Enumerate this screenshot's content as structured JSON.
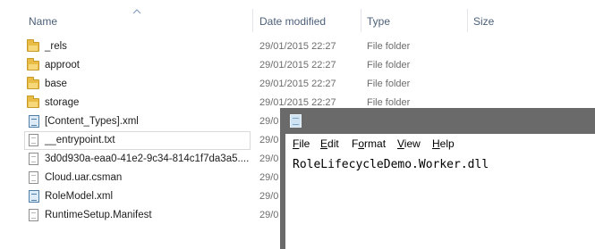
{
  "explorer": {
    "columns": {
      "name": "Name",
      "date_modified": "Date modified",
      "type": "Type",
      "size": "Size"
    },
    "sort_indicator_icon": "sort-ascending-arrow-icon",
    "rows": [
      {
        "name": "_rels",
        "date": "29/01/2015 22:27",
        "type": "File folder",
        "icon": "folder-icon"
      },
      {
        "name": "approot",
        "date": "29/01/2015 22:27",
        "type": "File folder",
        "icon": "folder-icon"
      },
      {
        "name": "base",
        "date": "29/01/2015 22:27",
        "type": "File folder",
        "icon": "folder-icon"
      },
      {
        "name": "storage",
        "date": "29/01/2015 22:27",
        "type": "File folder",
        "icon": "folder-icon"
      },
      {
        "name": "[Content_Types].xml",
        "date": "29/0",
        "type": "",
        "icon": "xml-file-icon"
      },
      {
        "name": "__entrypoint.txt",
        "date": "29/0",
        "type": "",
        "icon": "text-file-icon"
      },
      {
        "name": "3d0d930a-eaa0-41e2-9c34-814c1f7da3a5....",
        "date": "29/0",
        "type": "",
        "icon": "text-file-icon"
      },
      {
        "name": "Cloud.uar.csman",
        "date": "29/0",
        "type": "",
        "icon": "text-file-icon"
      },
      {
        "name": "RoleModel.xml",
        "date": "29/0",
        "type": "",
        "icon": "xml-file-icon"
      },
      {
        "name": "RuntimeSetup.Manifest",
        "date": "29/0",
        "type": "",
        "icon": "text-file-icon"
      }
    ]
  },
  "notepad": {
    "title_icon": "notepad-icon",
    "menu": [
      {
        "pre": "",
        "u": "F",
        "post": "ile"
      },
      {
        "pre": "",
        "u": "E",
        "post": "dit"
      },
      {
        "pre": "F",
        "u": "o",
        "post": "rmat"
      },
      {
        "pre": "",
        "u": "V",
        "post": "iew"
      },
      {
        "pre": "",
        "u": "H",
        "post": "elp"
      }
    ],
    "content": "RoleLifecycleDemo.Worker.dll"
  }
}
